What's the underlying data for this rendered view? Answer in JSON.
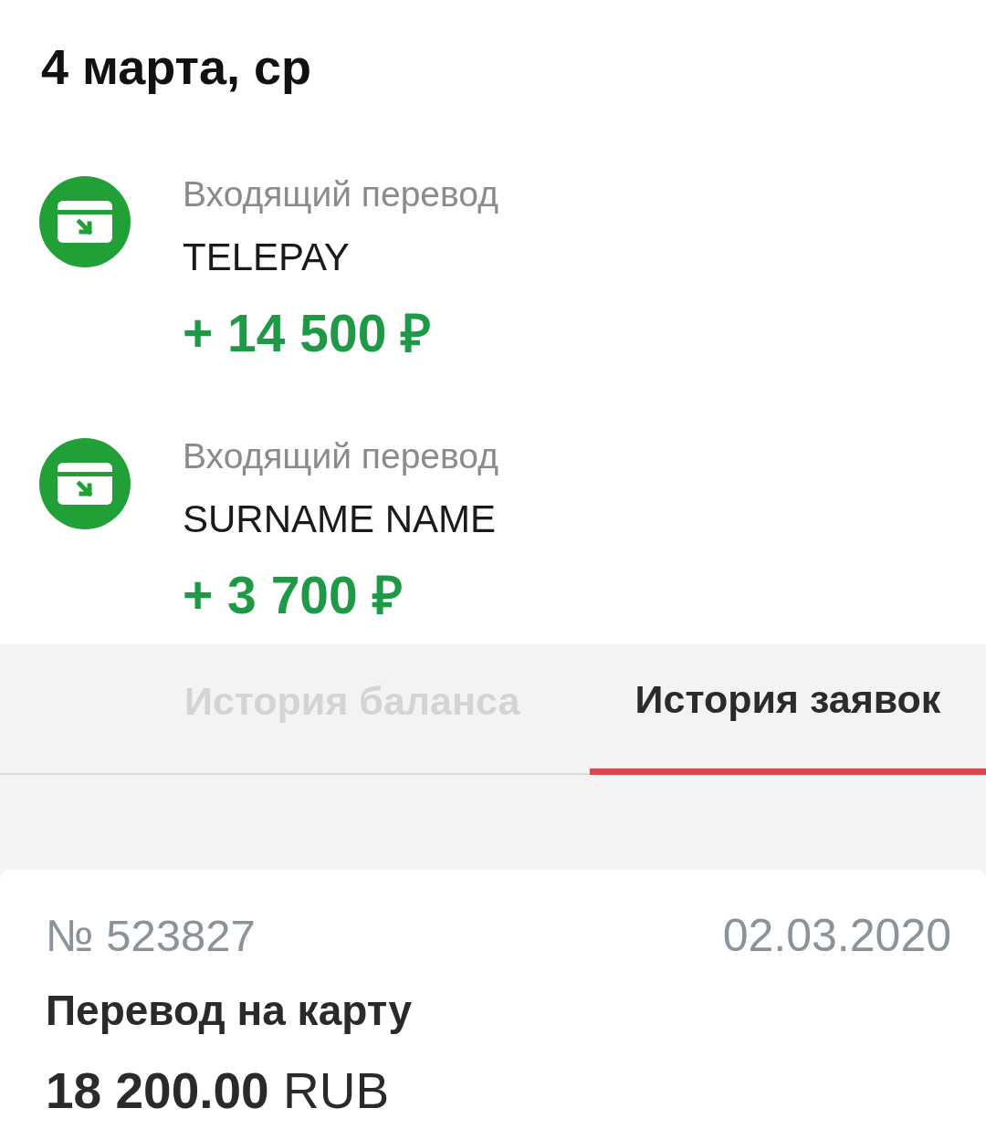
{
  "date_header": "4 марта, ср",
  "transactions": [
    {
      "type": "Входящий перевод",
      "counterparty": "TELEPAY",
      "amount": "+ 14 500 ₽"
    },
    {
      "type": "Входящий перевод",
      "counterparty": "SURNAME NAME",
      "amount": "+ 3 700 ₽"
    }
  ],
  "tabs": [
    {
      "label": "История баланса",
      "selected": false
    },
    {
      "label": "История заявок",
      "selected": true
    }
  ],
  "requests": [
    {
      "number": "№ 523827",
      "date": "02.03.2020",
      "title": "Перевод на карту",
      "amount": "**18 200.00** RUB"
    }
  ]
}
